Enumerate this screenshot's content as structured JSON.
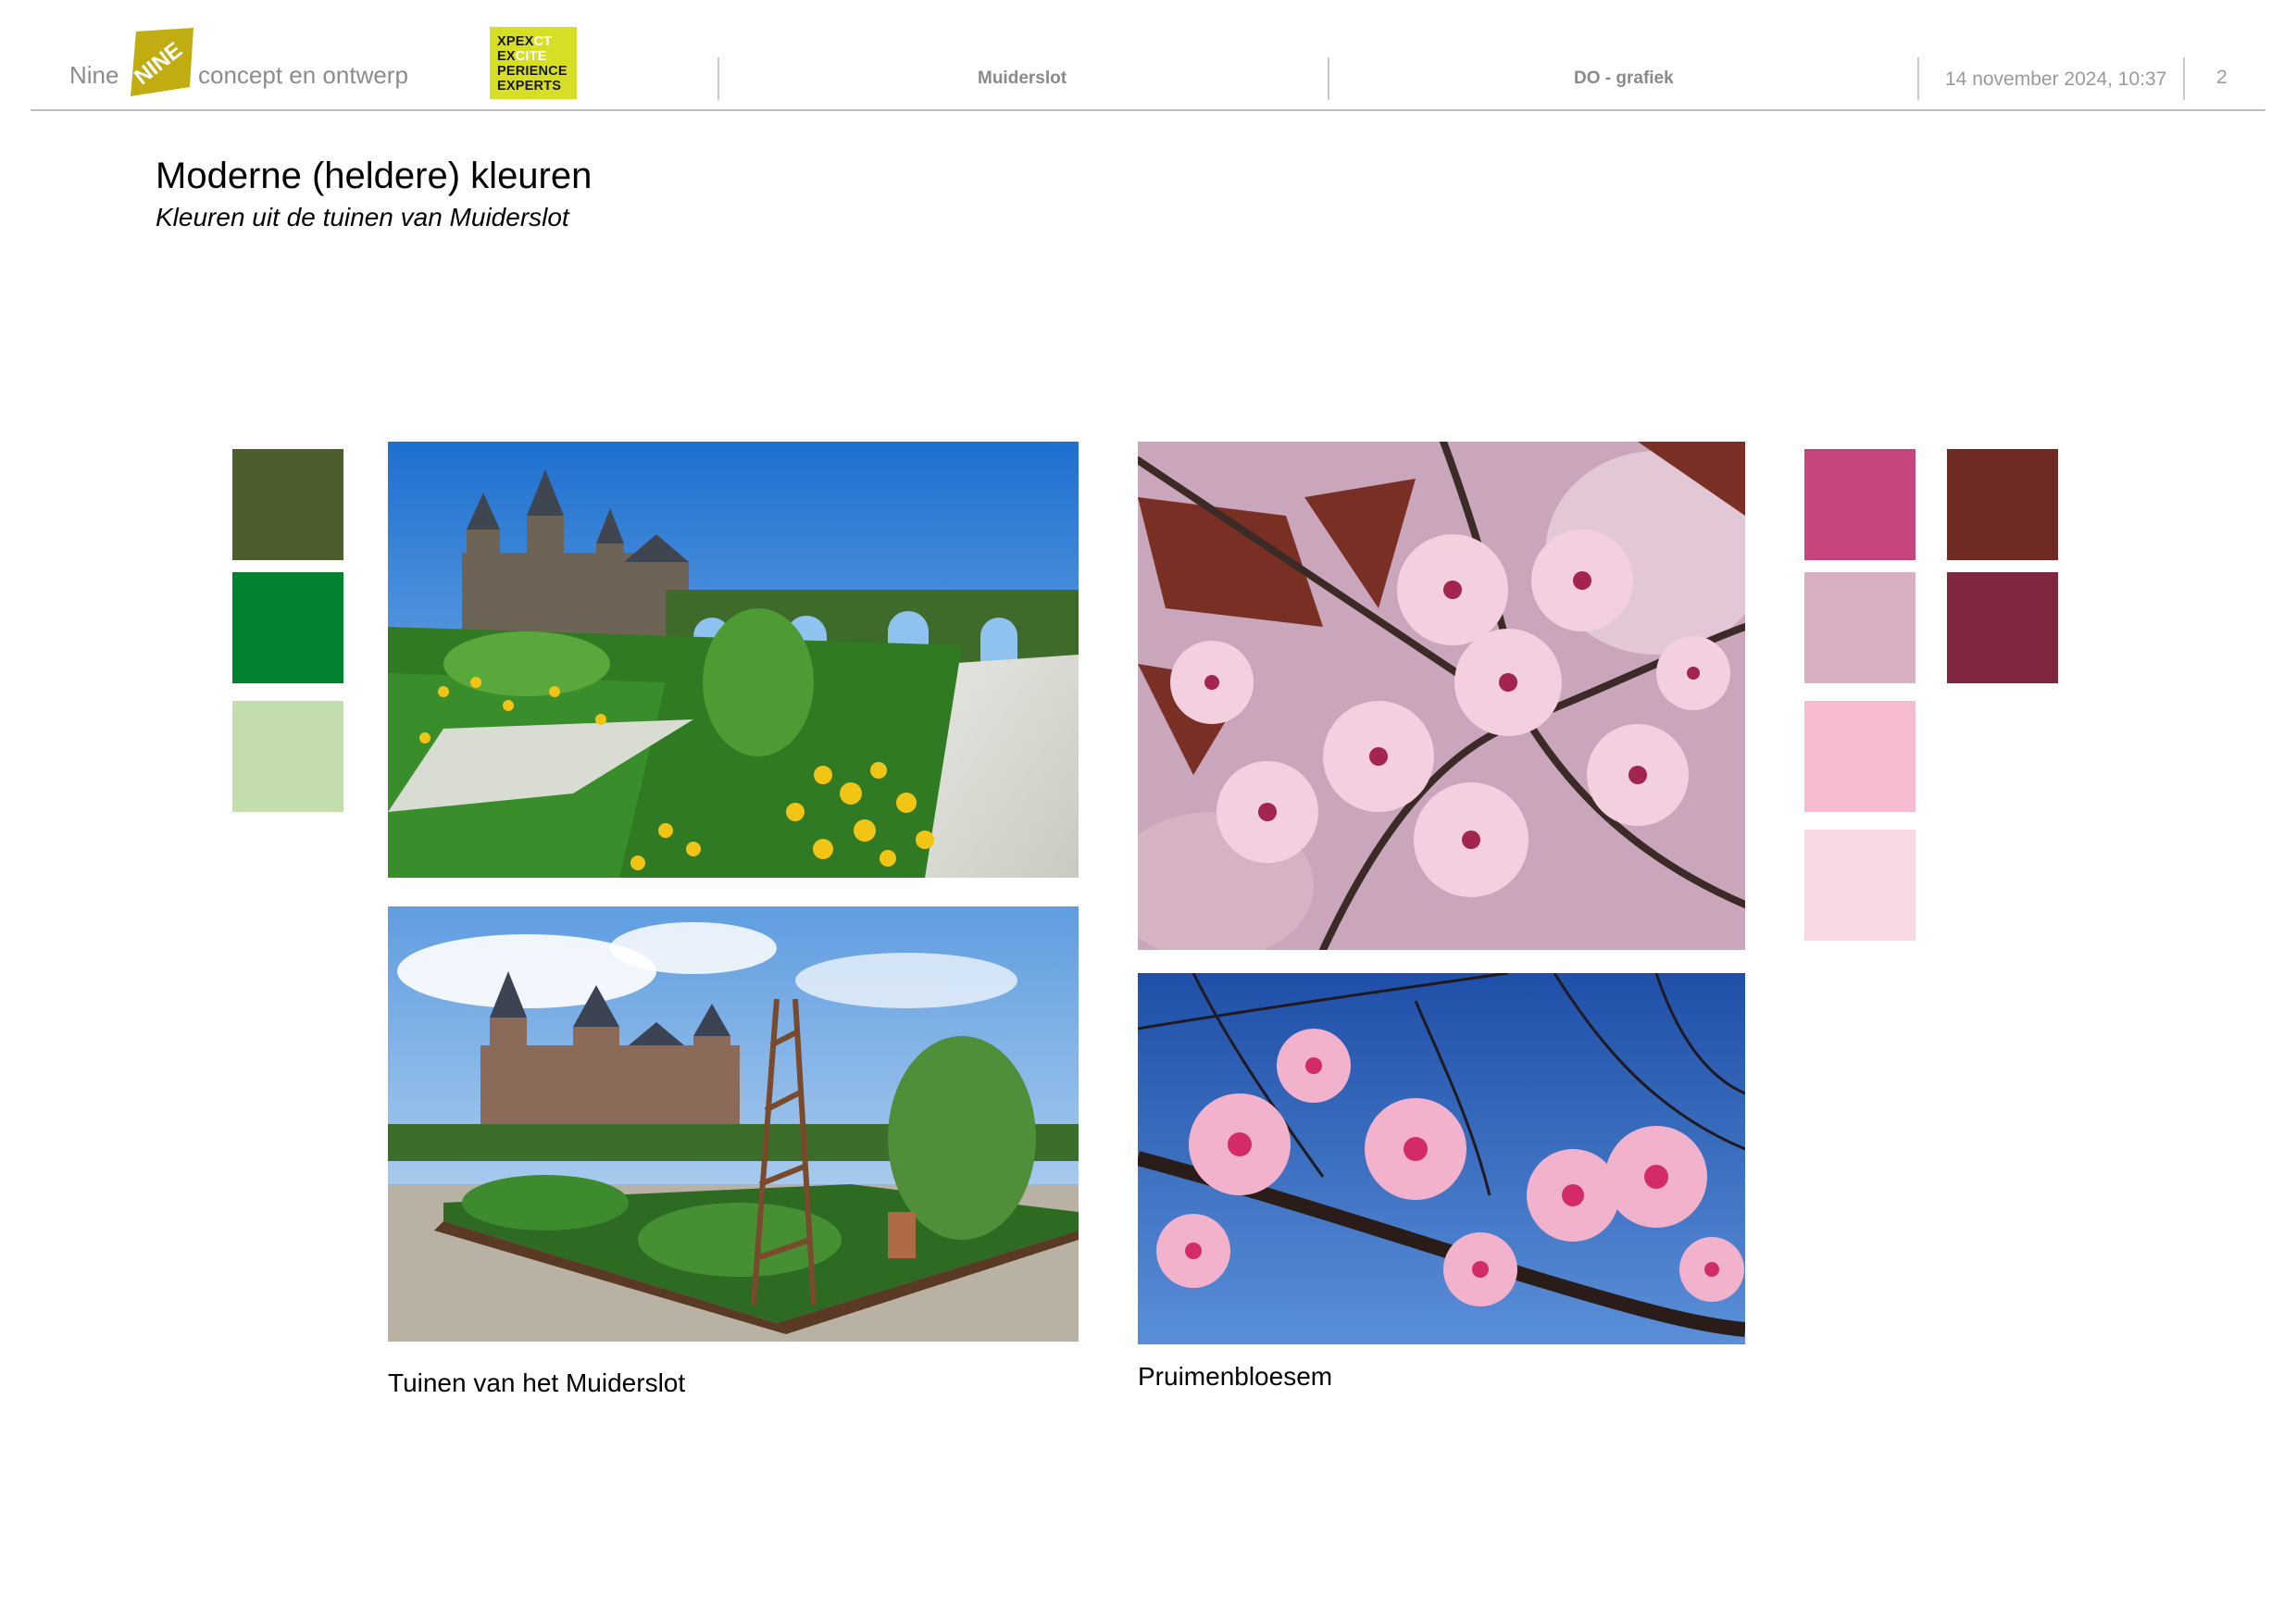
{
  "header": {
    "brand_nine": "Nine",
    "brand_logo_text": "NINE",
    "brand_tagline": "concept en ontwerp",
    "xpect_logo": {
      "lines": [
        [
          {
            "t": "XPEX",
            "w": false
          },
          {
            "t": "CT",
            "w": true
          }
        ],
        [
          {
            "t": "EX",
            "w": false
          },
          {
            "t": "CITE",
            "w": true
          }
        ],
        [
          {
            "t": "PERIENCE",
            "w": false
          }
        ],
        [
          {
            "t": "EXPERTS",
            "w": false
          }
        ]
      ]
    },
    "project": "Muiderslot",
    "phase": "DO - grafiek",
    "date": "14 november 2024, 10:37",
    "page_number": "2"
  },
  "title": "Moderne (heldere) kleuren",
  "subtitle": "Kleuren uit de tuinen van Muiderslot",
  "palette_green": [
    "#4d5e2e",
    "#00822f",
    "#c3ddad"
  ],
  "palette_pink": [
    "#c6457d",
    "#dbafc3",
    "#f5bcd1",
    "#f8d8e2"
  ],
  "palette_red": [
    "#6e2a23",
    "#7f273f"
  ],
  "captions": {
    "garden": "Tuinen van het Muiderslot",
    "blossom": "Pruimenbloesem"
  },
  "colors": {
    "logo_yellow": "#d6df26",
    "header_grey": "#8c8c8c",
    "rule_grey": "#bdbdbd"
  }
}
